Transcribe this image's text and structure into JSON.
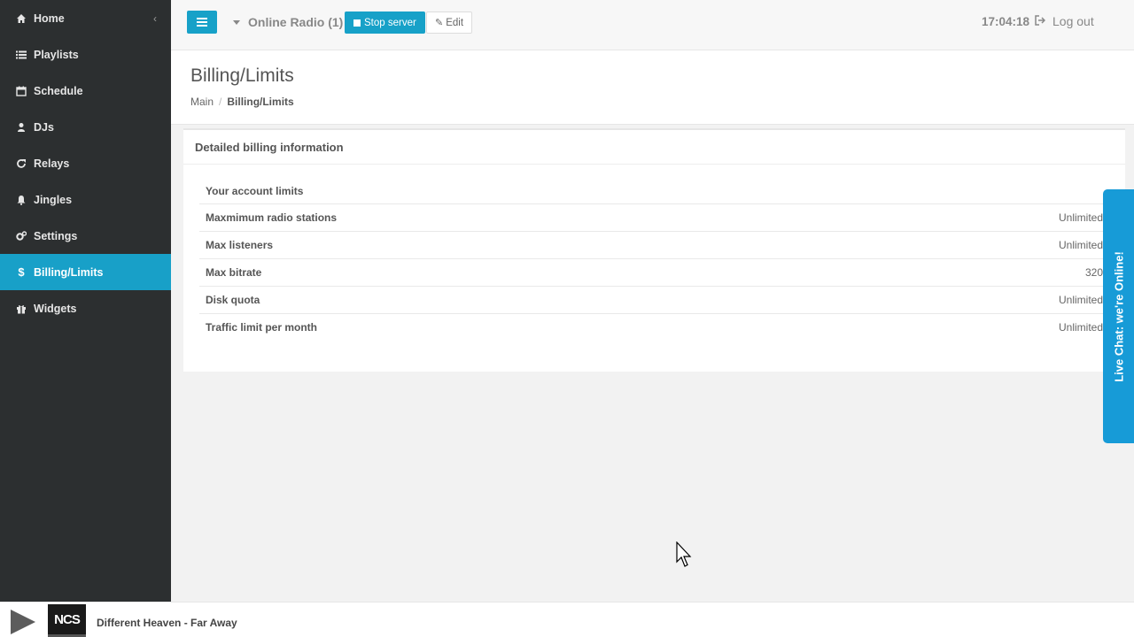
{
  "sidebar": {
    "items": [
      {
        "label": "Home",
        "icon": "home-icon"
      },
      {
        "label": "Playlists",
        "icon": "list-icon"
      },
      {
        "label": "Schedule",
        "icon": "calendar-icon"
      },
      {
        "label": "DJs",
        "icon": "user-icon"
      },
      {
        "label": "Relays",
        "icon": "refresh-icon"
      },
      {
        "label": "Jingles",
        "icon": "bell-icon"
      },
      {
        "label": "Settings",
        "icon": "gears-icon"
      },
      {
        "label": "Billing/Limits",
        "icon": "dollar-icon",
        "active": true
      },
      {
        "label": "Widgets",
        "icon": "gift-icon"
      }
    ],
    "collapse_glyph": "‹"
  },
  "topbar": {
    "radio_label": "Online Radio (1)",
    "stop_label": "Stop server",
    "edit_label": "Edit",
    "clock": "17:04:18",
    "logout_label": "Log out"
  },
  "page": {
    "title": "Billing/Limits",
    "breadcrumb": {
      "root": "Main",
      "current": "Billing/Limits"
    }
  },
  "panel": {
    "heading": "Detailed billing information",
    "table_header": "Your account limits",
    "rows": [
      {
        "label": "Maxmimum radio stations",
        "value": "Unlimited"
      },
      {
        "label": "Max listeners",
        "value": "Unlimited"
      },
      {
        "label": "Max bitrate",
        "value": "320"
      },
      {
        "label": "Disk quota",
        "value": "Unlimited"
      },
      {
        "label": "Traffic limit per month",
        "value": "Unlimited"
      }
    ]
  },
  "livechat": {
    "label": "Live Chat: we're Online!"
  },
  "player": {
    "track": "Different Heaven - Far Away",
    "cover_text": "NCS"
  },
  "colors": {
    "accent": "#18a0c8",
    "sidebar_bg": "#2c2f30",
    "livechat": "#179bd7"
  }
}
